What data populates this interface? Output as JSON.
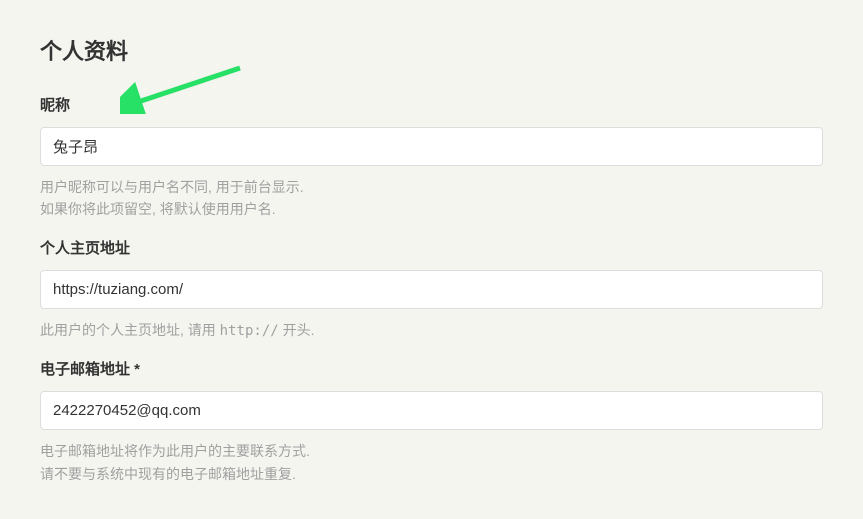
{
  "section_title": "个人资料",
  "fields": {
    "nickname": {
      "label": "昵称",
      "value": "兔子昂",
      "help_line1": "用户昵称可以与用户名不同, 用于前台显示.",
      "help_line2": "如果你将此项留空, 将默认使用用户名."
    },
    "homepage": {
      "label": "个人主页地址",
      "value": "https://tuziang.com/",
      "help_prefix": "此用户的个人主页地址, 请用 ",
      "help_code": "http://",
      "help_suffix": " 开头."
    },
    "email": {
      "label": "电子邮箱地址 *",
      "value": "2422270452@qq.com",
      "help_line1": "电子邮箱地址将作为此用户的主要联系方式.",
      "help_line2": "请不要与系统中现有的电子邮箱地址重复."
    }
  },
  "annotation": {
    "arrow_color": "#27e066"
  }
}
